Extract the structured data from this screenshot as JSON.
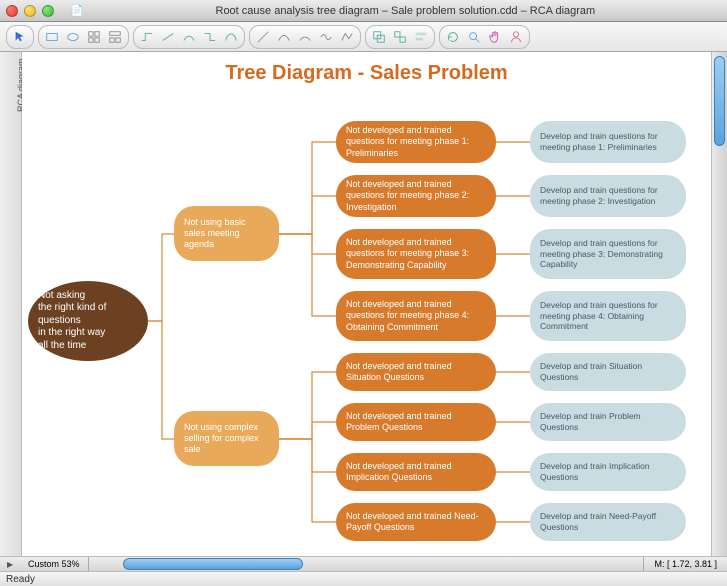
{
  "window": {
    "title": "Root cause analysis tree diagram – Sale problem solution.cdd – RCA diagram",
    "tab": "RCA diagram"
  },
  "page": {
    "title": "Tree Diagram - Sales Problem"
  },
  "zoom": {
    "label": "Custom 53%"
  },
  "status": {
    "ready": "Ready",
    "coords": "M: [ 1.72, 3.81 ]"
  },
  "nodes": {
    "root": "Not asking\nthe right kind of questions\nin the right way\nall the time",
    "l2a": "Not using basic sales meeting agenda",
    "l2b": "Not using complex selling for complex sale",
    "l3": [
      "Not developed and trained questions for meeting phase 1: Preliminaries",
      "Not developed and trained questions for meeting phase 2: Investigation",
      "Not developed and trained questions for meeting phase 3: Demonstrating Capability",
      "Not developed and trained questions for meeting phase 4: Obtaining Commitment",
      "Not developed and trained Situation Questions",
      "Not developed and trained Problem Questions",
      "Not developed and trained Implication Questions",
      "Not developed and trained Need-Payoff Questions"
    ],
    "l4": [
      "Develop and train questions for meeting phase 1: Preliminaries",
      "Develop and train questions for meeting phase 2: Investigation",
      "Develop and train questions for meeting phase 3: Demonstrating Capability",
      "Develop and train questions for meeting phase 4: Obtaining Commitment",
      "Develop and train Situation Questions",
      "Develop and train Problem Questions",
      "Develop and train Implication Questions",
      "Develop and train Need-Payoff Questions"
    ]
  }
}
